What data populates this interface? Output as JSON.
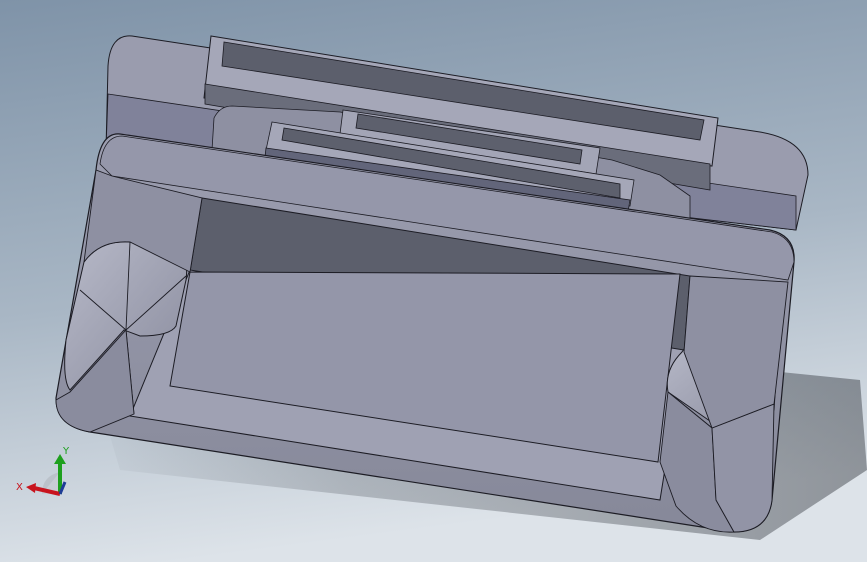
{
  "viewport": {
    "background_top": "#7f93a8",
    "background_bottom": "#dfe5ea"
  },
  "model": {
    "face_light": "#a6a8b8",
    "face_mid": "#8f91a3",
    "face_dark": "#5a5d6a",
    "edge": "#1c1c24"
  },
  "triad": {
    "x_label": "X",
    "y_label": "Y",
    "x_color": "#c8141e",
    "y_color": "#1ea01e",
    "z_color": "#1e3c96"
  }
}
